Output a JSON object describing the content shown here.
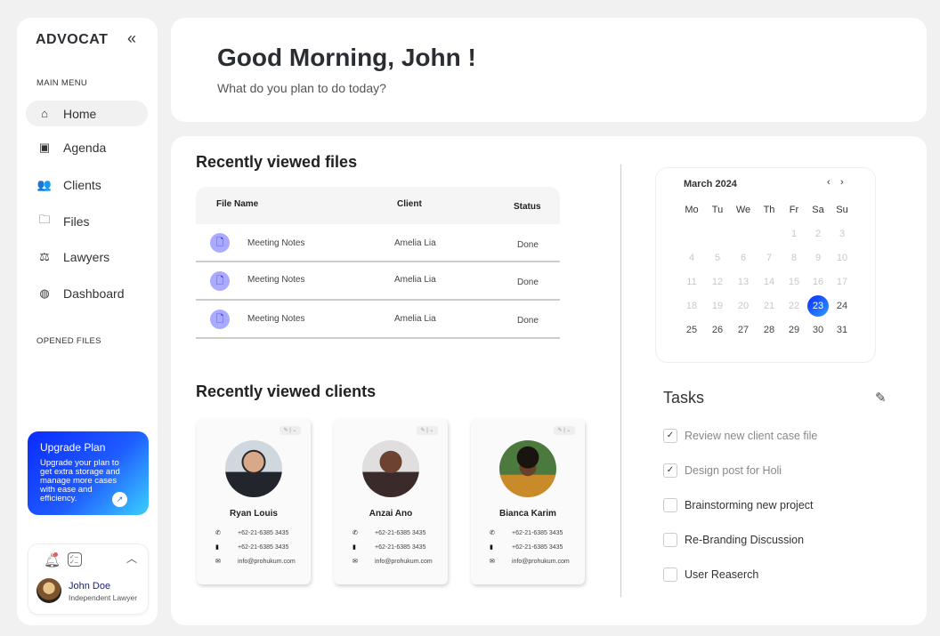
{
  "sidebar": {
    "logo": "ADVOCAT",
    "main_menu": "MAIN MENU",
    "opened_files": "OPENED FILES",
    "items": [
      {
        "label": "Home",
        "icon": "home-icon"
      },
      {
        "label": "Agenda",
        "icon": "calendar-icon"
      },
      {
        "label": "Clients",
        "icon": "users-icon"
      },
      {
        "label": "Files",
        "icon": "folder-icon"
      },
      {
        "label": "Lawyers",
        "icon": "scale-icon"
      },
      {
        "label": "Dashboard",
        "icon": "dashboard-icon"
      }
    ],
    "upgrade": {
      "title": "Upgrade Plan",
      "text": "Upgrade your plan to get extra storage and manage more cases with ease and efficiency."
    },
    "profile": {
      "name": "John Doe",
      "role": "Independent Lawyer"
    }
  },
  "header": {
    "greeting": "Good Morning, John !",
    "subtitle": "What do you plan to do today?"
  },
  "files": {
    "title": "Recently viewed files",
    "columns": [
      "File Name",
      "Client",
      "Status"
    ],
    "rows": [
      {
        "name": "Meeting Notes",
        "client": "Amelia Lia",
        "status": "Done"
      },
      {
        "name": "Meeting Notes",
        "client": "Amelia Lia",
        "status": "Done"
      },
      {
        "name": "Meeting Notes",
        "client": "Amelia Lia",
        "status": "Done"
      }
    ]
  },
  "clients": {
    "title": "Recently viewed clients",
    "cards": [
      {
        "name": "Ryan Louis",
        "phone": "+62-21-6385 3435",
        "mobile": "+62-21-6385 3435",
        "email": "info@prohukum.com"
      },
      {
        "name": "Anzai Ano",
        "phone": "+62-21-6385 3435",
        "mobile": "+62-21-6385 3435",
        "email": "info@prohukum.com"
      },
      {
        "name": "Bianca Karim",
        "phone": "+62-21-6385 3435",
        "mobile": "+62-21-6385 3435",
        "email": "info@prohukum.com"
      }
    ]
  },
  "calendar": {
    "month": "March 2024",
    "weekdays": [
      "Mo",
      "Tu",
      "We",
      "Th",
      "Fr",
      "Sa",
      "Su"
    ],
    "first_weekday_index": 4,
    "days_in_month": 31,
    "selected": 23,
    "prev": "‹",
    "next": "›"
  },
  "tasks": {
    "title": "Tasks",
    "items": [
      {
        "label": "Review new client case file",
        "done": true
      },
      {
        "label": "Design post for Holi",
        "done": true
      },
      {
        "label": "Brainstorming new project",
        "done": false
      },
      {
        "label": "Re-Branding Discussion",
        "done": false
      },
      {
        "label": "User Reaserch",
        "done": false
      }
    ]
  },
  "colors": {
    "accent": "#0a2bff",
    "file_icon_bg": "#aaaaff"
  }
}
